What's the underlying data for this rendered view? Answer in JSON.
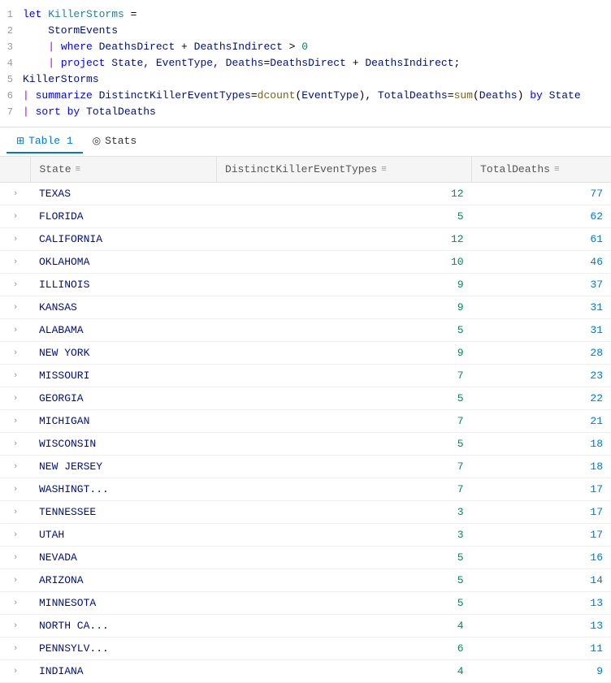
{
  "code": {
    "lines": [
      {
        "num": 1,
        "tokens": [
          {
            "text": "let ",
            "class": "kw-let"
          },
          {
            "text": "KillerStorms",
            "class": "kw-var"
          },
          {
            "text": " =",
            "class": "kw-operator"
          }
        ]
      },
      {
        "num": 2,
        "tokens": [
          {
            "text": "    StormEvents",
            "class": "kw-plain"
          }
        ]
      },
      {
        "num": 3,
        "tokens": [
          {
            "text": "    | ",
            "class": "kw-pipe"
          },
          {
            "text": "where ",
            "class": "kw-keyword"
          },
          {
            "text": "DeathsDirect",
            "class": "kw-plain"
          },
          {
            "text": " + ",
            "class": "kw-operator"
          },
          {
            "text": "DeathsIndirect",
            "class": "kw-plain"
          },
          {
            "text": " > ",
            "class": "kw-operator"
          },
          {
            "text": "0",
            "class": "kw-green"
          }
        ]
      },
      {
        "num": 4,
        "tokens": [
          {
            "text": "    | ",
            "class": "kw-pipe"
          },
          {
            "text": "project ",
            "class": "kw-keyword"
          },
          {
            "text": "State, EventType, Deaths",
            "class": "kw-plain"
          },
          {
            "text": "=",
            "class": "kw-operator"
          },
          {
            "text": "DeathsDirect",
            "class": "kw-plain"
          },
          {
            "text": " + ",
            "class": "kw-operator"
          },
          {
            "text": "DeathsIndirect",
            "class": "kw-plain"
          },
          {
            "text": ";",
            "class": "kw-operator"
          }
        ]
      },
      {
        "num": 5,
        "tokens": [
          {
            "text": "KillerStorms",
            "class": "kw-plain"
          }
        ]
      },
      {
        "num": 6,
        "tokens": [
          {
            "text": "| ",
            "class": "kw-pipe"
          },
          {
            "text": "summarize ",
            "class": "kw-keyword"
          },
          {
            "text": "DistinctKillerEventTypes",
            "class": "kw-plain"
          },
          {
            "text": "=",
            "class": "kw-operator"
          },
          {
            "text": "dcount",
            "class": "kw-func"
          },
          {
            "text": "(",
            "class": "kw-operator"
          },
          {
            "text": "EventType",
            "class": "kw-plain"
          },
          {
            "text": "), ",
            "class": "kw-operator"
          },
          {
            "text": "TotalDeaths",
            "class": "kw-plain"
          },
          {
            "text": "=",
            "class": "kw-operator"
          },
          {
            "text": "sum",
            "class": "kw-func"
          },
          {
            "text": "(",
            "class": "kw-operator"
          },
          {
            "text": "Deaths",
            "class": "kw-plain"
          },
          {
            "text": ") ",
            "class": "kw-operator"
          },
          {
            "text": "by ",
            "class": "kw-keyword"
          },
          {
            "text": "State",
            "class": "kw-plain"
          }
        ]
      },
      {
        "num": 7,
        "tokens": [
          {
            "text": "| ",
            "class": "kw-pipe"
          },
          {
            "text": "sort ",
            "class": "kw-keyword"
          },
          {
            "text": "by ",
            "class": "kw-keyword"
          },
          {
            "text": "TotalDeaths",
            "class": "kw-plain"
          }
        ]
      }
    ]
  },
  "tabs": [
    {
      "label": "Table 1",
      "icon": "⊞",
      "active": true
    },
    {
      "label": "Stats",
      "icon": "◎",
      "active": false
    }
  ],
  "table": {
    "columns": [
      {
        "key": "expander",
        "label": ""
      },
      {
        "key": "state",
        "label": "State"
      },
      {
        "key": "distinct",
        "label": "DistinctKillerEventTypes"
      },
      {
        "key": "total",
        "label": "TotalDeaths"
      }
    ],
    "rows": [
      {
        "state": "TEXAS",
        "distinct": 12,
        "total": 77
      },
      {
        "state": "FLORIDA",
        "distinct": 5,
        "total": 62
      },
      {
        "state": "CALIFORNIA",
        "distinct": 12,
        "total": 61
      },
      {
        "state": "OKLAHOMA",
        "distinct": 10,
        "total": 46
      },
      {
        "state": "ILLINOIS",
        "distinct": 9,
        "total": 37
      },
      {
        "state": "KANSAS",
        "distinct": 9,
        "total": 31
      },
      {
        "state": "ALABAMA",
        "distinct": 5,
        "total": 31
      },
      {
        "state": "NEW YORK",
        "distinct": 9,
        "total": 28
      },
      {
        "state": "MISSOURI",
        "distinct": 7,
        "total": 23
      },
      {
        "state": "GEORGIA",
        "distinct": 5,
        "total": 22
      },
      {
        "state": "MICHIGAN",
        "distinct": 7,
        "total": 21
      },
      {
        "state": "WISCONSIN",
        "distinct": 5,
        "total": 18
      },
      {
        "state": "NEW JERSEY",
        "distinct": 7,
        "total": 18
      },
      {
        "state": "WASHINGT...",
        "distinct": 7,
        "total": 17
      },
      {
        "state": "TENNESSEE",
        "distinct": 3,
        "total": 17
      },
      {
        "state": "UTAH",
        "distinct": 3,
        "total": 17
      },
      {
        "state": "NEVADA",
        "distinct": 5,
        "total": 16
      },
      {
        "state": "ARIZONA",
        "distinct": 5,
        "total": 14
      },
      {
        "state": "MINNESOTA",
        "distinct": 5,
        "total": 13
      },
      {
        "state": "NORTH CA...",
        "distinct": 4,
        "total": 13
      },
      {
        "state": "PENNSYLV...",
        "distinct": 6,
        "total": 11
      },
      {
        "state": "INDIANA",
        "distinct": 4,
        "total": 9
      }
    ]
  }
}
